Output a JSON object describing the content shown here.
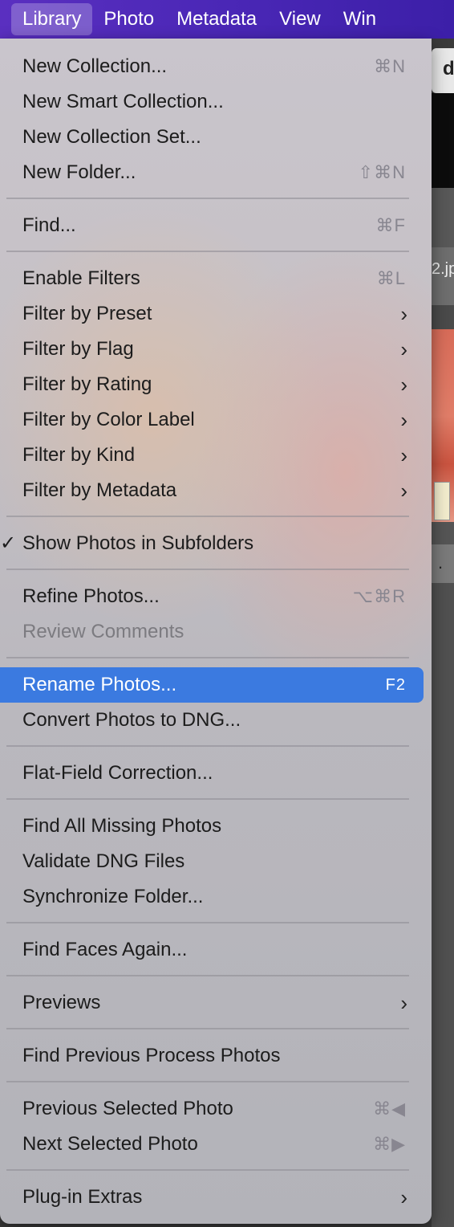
{
  "menubar": {
    "items": [
      "Library",
      "Photo",
      "Metadata",
      "View",
      "Win"
    ]
  },
  "background": {
    "tab_letter": "d",
    "file_text": "2.jp",
    "dot": "."
  },
  "menu": {
    "new_collection": {
      "label": "New Collection...",
      "shortcut": "⌘N"
    },
    "new_smart_collection": {
      "label": "New Smart Collection..."
    },
    "new_collection_set": {
      "label": "New Collection Set..."
    },
    "new_folder": {
      "label": "New Folder...",
      "shortcut": "⇧⌘N"
    },
    "find": {
      "label": "Find...",
      "shortcut": "⌘F"
    },
    "enable_filters": {
      "label": "Enable Filters",
      "shortcut": "⌘L"
    },
    "filter_preset": {
      "label": "Filter by Preset"
    },
    "filter_flag": {
      "label": "Filter by Flag"
    },
    "filter_rating": {
      "label": "Filter by Rating"
    },
    "filter_color": {
      "label": "Filter by Color Label"
    },
    "filter_kind": {
      "label": "Filter by Kind"
    },
    "filter_metadata": {
      "label": "Filter by Metadata"
    },
    "show_subfolders": {
      "label": "Show Photos in Subfolders",
      "checked": true
    },
    "refine_photos": {
      "label": "Refine Photos...",
      "shortcut": "⌥⌘R"
    },
    "review_comments": {
      "label": "Review Comments",
      "disabled": true
    },
    "rename_photos": {
      "label": "Rename Photos...",
      "shortcut": "F2",
      "highlighted": true
    },
    "convert_dng": {
      "label": "Convert Photos to DNG..."
    },
    "flat_field": {
      "label": "Flat-Field Correction..."
    },
    "find_missing": {
      "label": "Find All Missing Photos"
    },
    "validate_dng": {
      "label": "Validate DNG Files"
    },
    "synchronize": {
      "label": "Synchronize Folder..."
    },
    "find_faces": {
      "label": "Find Faces Again..."
    },
    "previews": {
      "label": "Previews"
    },
    "find_previous_process": {
      "label": "Find Previous Process Photos"
    },
    "previous_selected": {
      "label": "Previous Selected Photo",
      "shortcut": "⌘◀"
    },
    "next_selected": {
      "label": "Next Selected Photo",
      "shortcut": "⌘▶"
    },
    "plugin_extras": {
      "label": "Plug-in Extras"
    }
  },
  "icons": {
    "submenu_arrow": "›",
    "checkmark": "✓"
  },
  "colors": {
    "menubar_bg": "#4a27b6",
    "highlight": "#3b7ae0"
  }
}
